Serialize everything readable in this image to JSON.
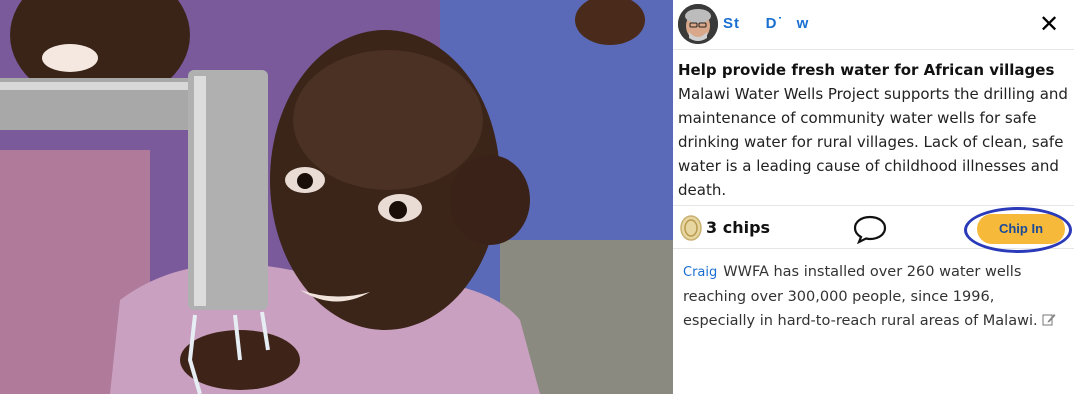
{
  "project": {
    "author_name": "St     D˙   w",
    "headline": "Help provide fresh water for African villages",
    "body": " Malawi Water Wells Project supports the drilling and maintenance of community water wells for safe drinking water for rural villages. Lack of clean, safe water is a leading cause of childhood illnesses and death."
  },
  "actions": {
    "chips_label": "3 chips",
    "chip_in_label": "Chip In"
  },
  "comment": {
    "author": "Craig",
    "text": "WWFA has installed over 260 water wells reaching over 300,000 people, since 1996, especially in hard-to-reach rural areas of Malawi."
  },
  "icons": {
    "close": "close-icon",
    "chip": "chip-coin-icon",
    "comment": "speech-bubble-icon",
    "edit": "pencil-edit-icon"
  },
  "colors": {
    "link_blue": "#1a6fd1",
    "chip_in_button": "#f6b93a",
    "highlight_ring": "#2a3ab8"
  }
}
